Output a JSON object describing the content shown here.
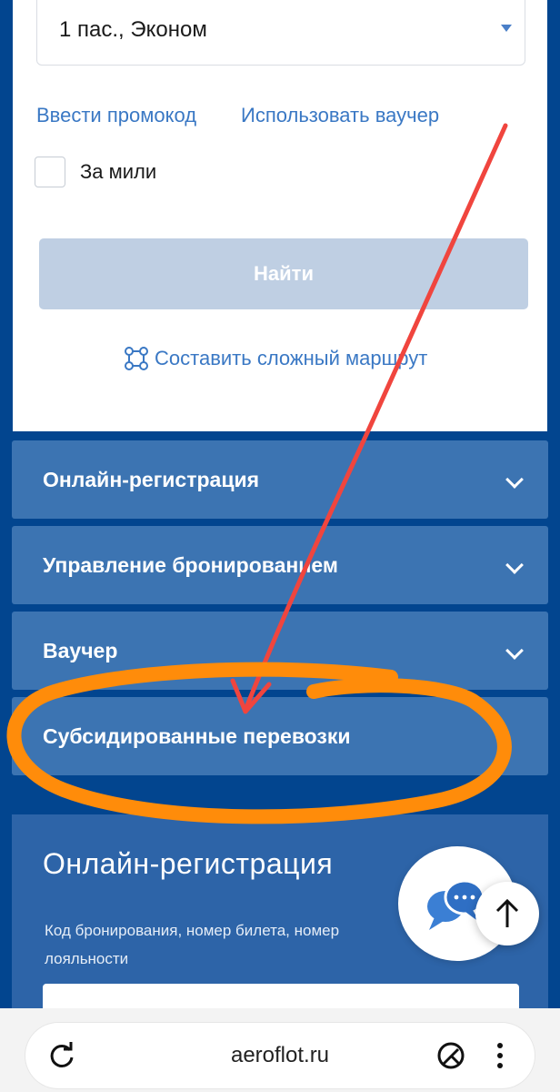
{
  "search": {
    "passengers_value": "1 пас., Эконом",
    "promo_link": "Ввести промокод",
    "voucher_link": "Использовать ваучер",
    "miles_label": "За мили",
    "miles_checked": false,
    "find_button": "Найти",
    "complex_route_link": "Составить сложный маршрут"
  },
  "accordion": {
    "items": [
      {
        "label": "Онлайн-регистрация",
        "icon": "chevron-down-icon"
      },
      {
        "label": "Управление бронированием",
        "icon": "chevron-down-icon"
      },
      {
        "label": "Ваучер",
        "icon": "chevron-down-icon"
      },
      {
        "label": "Субсидированные перевозки"
      }
    ]
  },
  "checkin": {
    "title": "Онлайн-регистрация",
    "description": "Код бронирования, номер билета, номер лояльности"
  },
  "browser": {
    "url": "aeroflot.ru"
  },
  "colors": {
    "page_background": "#02458f",
    "accordion_row": "#3c74b2",
    "link": "#3a78c4",
    "annotation_arrow": "#f0453e",
    "annotation_circle": "#ff8c0a"
  }
}
